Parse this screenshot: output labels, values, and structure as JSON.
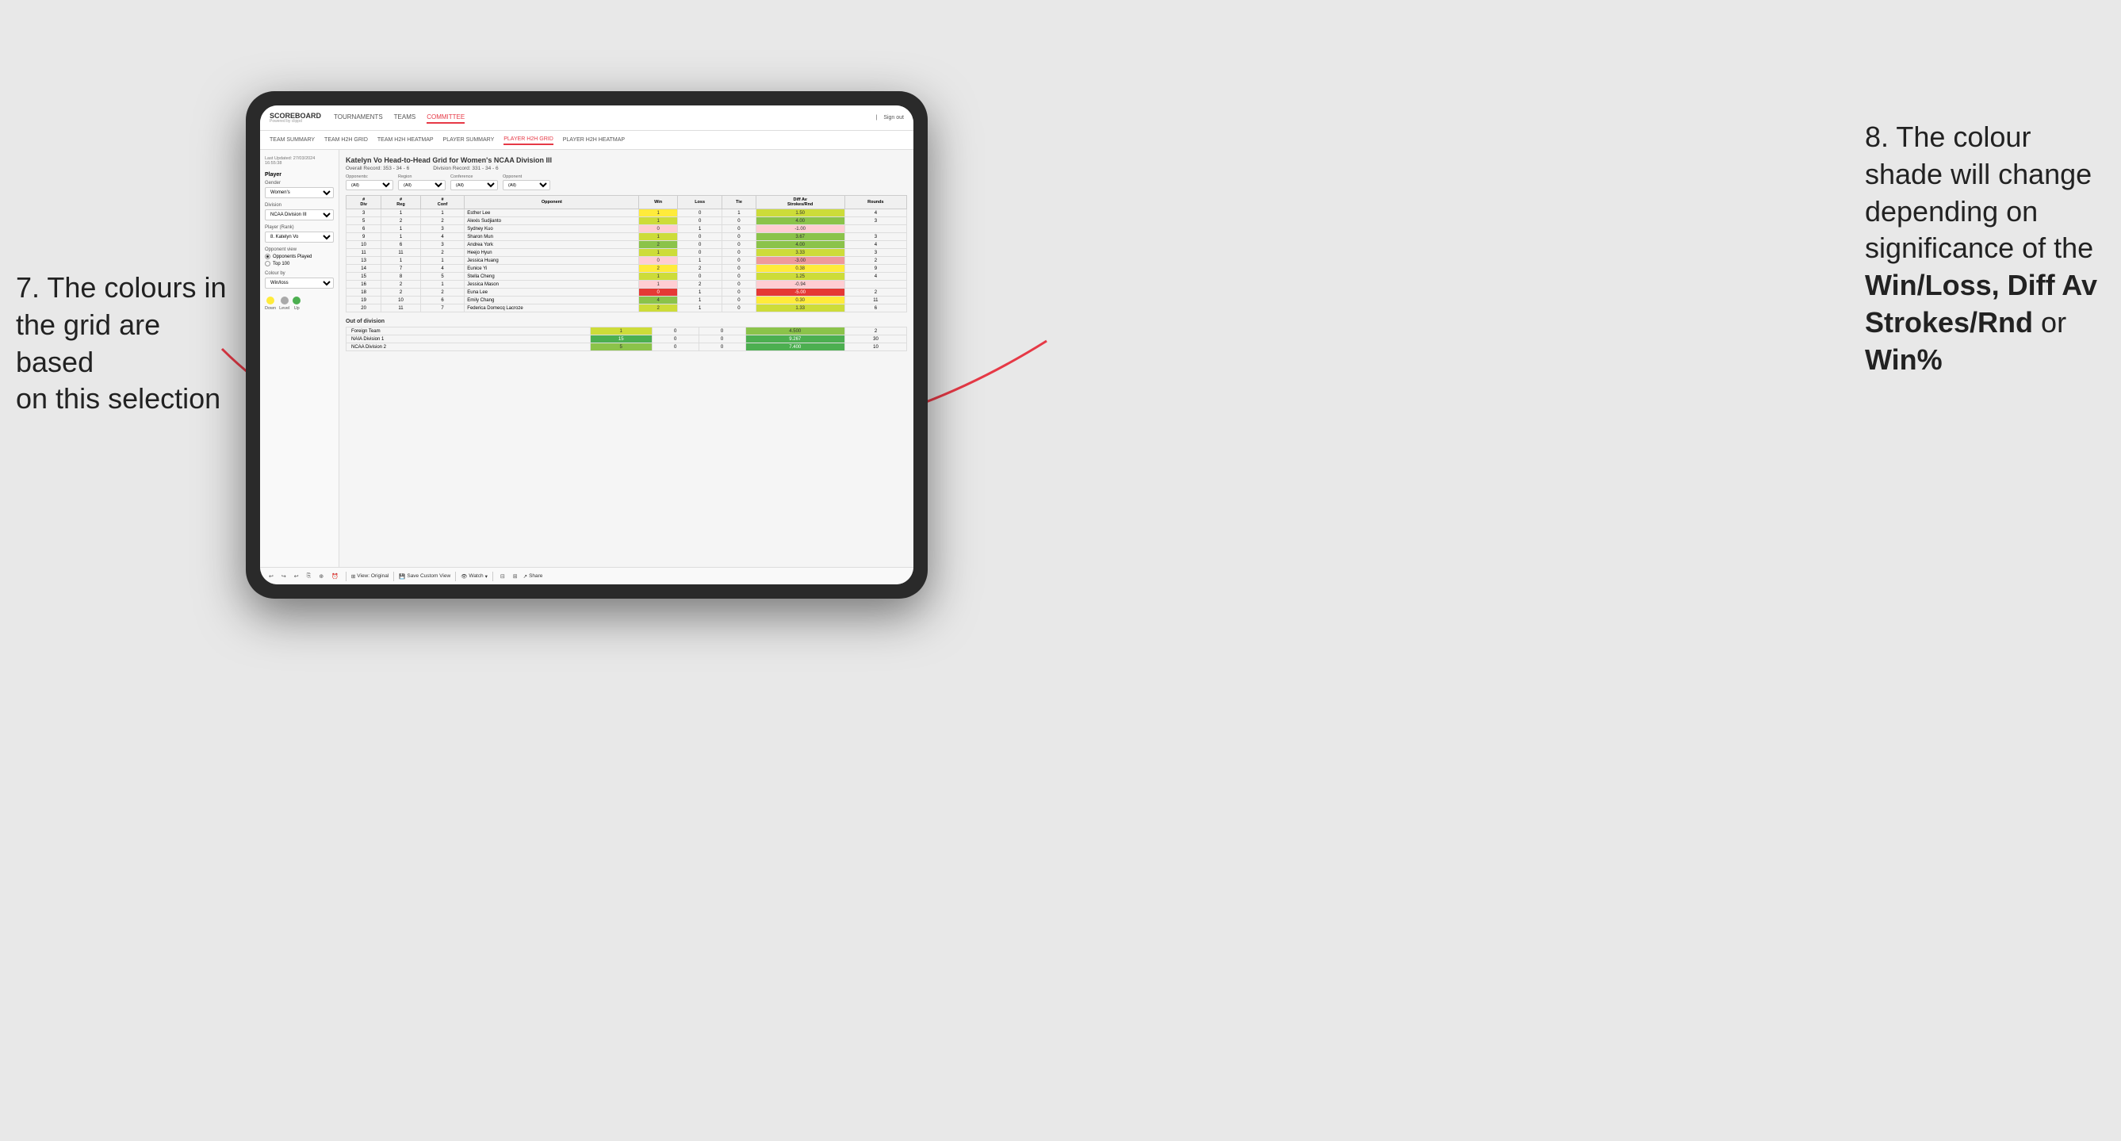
{
  "annotations": {
    "left_text_line1": "7. The colours in",
    "left_text_line2": "the grid are based",
    "left_text_line3": "on this selection",
    "right_text_line1": "8. The colour",
    "right_text_line2": "shade will change",
    "right_text_line3": "depending on",
    "right_text_line4": "significance of the",
    "right_text_bold1": "Win/Loss, Diff Av",
    "right_text_bold2": "Strokes/Rnd",
    "right_text_bold3": "or",
    "right_text_bold4": "Win%"
  },
  "app": {
    "logo": "SCOREBOARD",
    "logo_sub": "Powered by clippd",
    "sign_out": "Sign out",
    "nav": {
      "tournaments": "TOURNAMENTS",
      "teams": "TEAMS",
      "committee": "COMMITTEE"
    },
    "subnav": {
      "team_summary": "TEAM SUMMARY",
      "team_h2h_grid": "TEAM H2H GRID",
      "team_h2h_heatmap": "TEAM H2H HEATMAP",
      "player_summary": "PLAYER SUMMARY",
      "player_h2h_grid": "PLAYER H2H GRID",
      "player_h2h_heatmap": "PLAYER H2H HEATMAP"
    }
  },
  "sidebar": {
    "timestamp_label": "Last Updated: 27/03/2024",
    "timestamp_time": "16:55:38",
    "player_section": "Player",
    "gender_label": "Gender",
    "gender_value": "Women's",
    "division_label": "Division",
    "division_value": "NCAA Division III",
    "player_rank_label": "Player (Rank)",
    "player_rank_value": "8. Katelyn Vo",
    "opponent_view_label": "Opponent view",
    "radio1": "Opponents Played",
    "radio2": "Top 100",
    "colour_by_label": "Colour by",
    "colour_by_value": "Win/loss",
    "legend": {
      "down": "Down",
      "level": "Level",
      "up": "Up"
    }
  },
  "grid": {
    "title": "Katelyn Vo Head-to-Head Grid for Women's NCAA Division III",
    "overall_record_label": "Overall Record:",
    "overall_record": "353 - 34 - 6",
    "division_record_label": "Division Record:",
    "division_record": "331 - 34 - 6",
    "filter_opponents_label": "Opponents:",
    "filter_region_label": "Region",
    "filter_conference_label": "Conference",
    "filter_opponent_label": "Opponent",
    "filter_all": "(All)",
    "col_headers": {
      "div": "#\nDiv",
      "reg": "#\nReg",
      "conf": "#\nConf",
      "opponent": "Opponent",
      "win": "Win",
      "loss": "Loss",
      "tie": "Tie",
      "diff_av": "Diff Av\nStrokes/Rnd",
      "rounds": "Rounds"
    },
    "rows": [
      {
        "div": 3,
        "reg": 1,
        "conf": 1,
        "opponent": "Esther Lee",
        "win": 1,
        "loss": 0,
        "tie": 1,
        "diff_av": 1.5,
        "rounds": 4,
        "win_color": "yellow",
        "diff_color": "green-light"
      },
      {
        "div": 5,
        "reg": 2,
        "conf": 2,
        "opponent": "Alexis Sudjianto",
        "win": 1,
        "loss": 0,
        "tie": 0,
        "diff_av": 4.0,
        "rounds": 3,
        "win_color": "green-light",
        "diff_color": "green-med"
      },
      {
        "div": 6,
        "reg": 1,
        "conf": 3,
        "opponent": "Sydney Kuo",
        "win": 0,
        "loss": 1,
        "tie": 0,
        "diff_av": -1.0,
        "rounds": "",
        "win_color": "red-light",
        "diff_color": "red-light"
      },
      {
        "div": 9,
        "reg": 1,
        "conf": 4,
        "opponent": "Sharon Mun",
        "win": 1,
        "loss": 0,
        "tie": 0,
        "diff_av": 3.67,
        "rounds": 3,
        "win_color": "green-light",
        "diff_color": "green-med"
      },
      {
        "div": 10,
        "reg": 6,
        "conf": 3,
        "opponent": "Andrea York",
        "win": 2,
        "loss": 0,
        "tie": 0,
        "diff_av": 4.0,
        "rounds": 4,
        "win_color": "green-med",
        "diff_color": "green-med"
      },
      {
        "div": 11,
        "reg": 11,
        "conf": 2,
        "opponent": "Heejo Hyun",
        "win": 1,
        "loss": 0,
        "tie": 0,
        "diff_av": 3.33,
        "rounds": 3,
        "win_color": "green-light",
        "diff_color": "green-light"
      },
      {
        "div": 13,
        "reg": 1,
        "conf": 1,
        "opponent": "Jessica Huang",
        "win": 0,
        "loss": 1,
        "tie": 0,
        "diff_av": -3.0,
        "rounds": 2,
        "win_color": "red-light",
        "diff_color": "red-med"
      },
      {
        "div": 14,
        "reg": 7,
        "conf": 4,
        "opponent": "Eunice Yi",
        "win": 2,
        "loss": 2,
        "tie": 0,
        "diff_av": 0.38,
        "rounds": 9,
        "win_color": "yellow",
        "diff_color": "yellow"
      },
      {
        "div": 15,
        "reg": 8,
        "conf": 5,
        "opponent": "Stella Cheng",
        "win": 1,
        "loss": 0,
        "tie": 0,
        "diff_av": 1.25,
        "rounds": 4,
        "win_color": "green-light",
        "diff_color": "green-light"
      },
      {
        "div": 16,
        "reg": 2,
        "conf": 1,
        "opponent": "Jessica Mason",
        "win": 1,
        "loss": 2,
        "tie": 0,
        "diff_av": -0.94,
        "rounds": "",
        "win_color": "red-light",
        "diff_color": "red-light"
      },
      {
        "div": 18,
        "reg": 2,
        "conf": 2,
        "opponent": "Euna Lee",
        "win": 0,
        "loss": 1,
        "tie": 0,
        "diff_av": -5.0,
        "rounds": 2,
        "win_color": "red-dark",
        "diff_color": "red-dark"
      },
      {
        "div": 19,
        "reg": 10,
        "conf": 6,
        "opponent": "Emily Chang",
        "win": 4,
        "loss": 1,
        "tie": 0,
        "diff_av": 0.3,
        "rounds": 11,
        "win_color": "green-med",
        "diff_color": "yellow"
      },
      {
        "div": 20,
        "reg": 11,
        "conf": 7,
        "opponent": "Federica Domecq Lacroze",
        "win": 2,
        "loss": 1,
        "tie": 0,
        "diff_av": 1.33,
        "rounds": 6,
        "win_color": "green-light",
        "diff_color": "green-light"
      }
    ],
    "out_of_division_label": "Out of division",
    "out_of_division_rows": [
      {
        "opponent": "Foreign Team",
        "win": 1,
        "loss": 0,
        "tie": 0,
        "diff_av": 4.5,
        "rounds": 2,
        "win_color": "green-light",
        "diff_color": "green-med"
      },
      {
        "opponent": "NAIA Division 1",
        "win": 15,
        "loss": 0,
        "tie": 0,
        "diff_av": 9.267,
        "rounds": 30,
        "win_color": "green-dark",
        "diff_color": "green-dark"
      },
      {
        "opponent": "NCAA Division 2",
        "win": 5,
        "loss": 0,
        "tie": 0,
        "diff_av": 7.4,
        "rounds": 10,
        "win_color": "green-med",
        "diff_color": "green-dark"
      }
    ]
  },
  "toolbar": {
    "view_original": "View: Original",
    "save_custom_view": "Save Custom View",
    "watch": "Watch",
    "share": "Share"
  }
}
